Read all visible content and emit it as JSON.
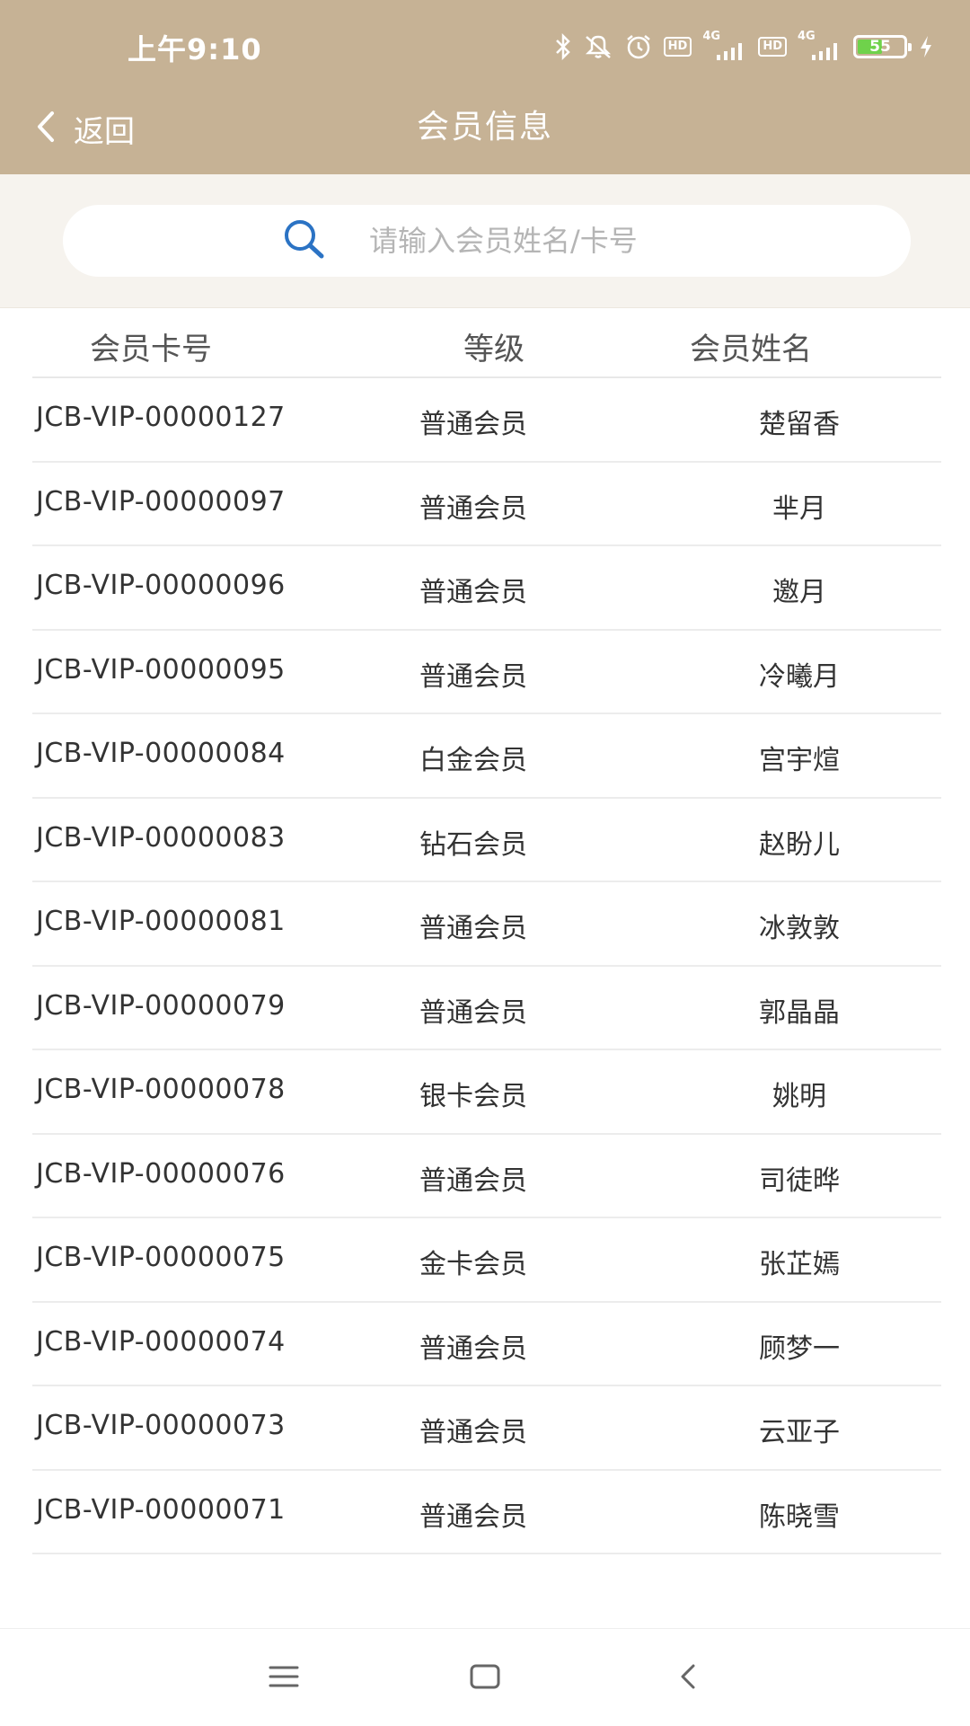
{
  "status_bar": {
    "time": "上午9:10",
    "icons": [
      "bluetooth-icon",
      "mute-icon",
      "alarm-icon",
      "hd-badge",
      "4g-signal-icon",
      "hd-badge",
      "4g-signal-icon",
      "battery-icon",
      "charging-icon"
    ],
    "hd_label": "HD",
    "network_label": "4G",
    "battery_level": 55,
    "battery_text": "55",
    "battery_color": "#6fd24b"
  },
  "header": {
    "back_label": "返回",
    "title": "会员信息",
    "background": "#c6b295"
  },
  "search": {
    "placeholder": "请输入会员姓名/卡号",
    "value": "",
    "icon": "search-icon",
    "icon_color": "#2b73c4"
  },
  "table": {
    "columns": [
      "会员卡号",
      "等级",
      "会员姓名"
    ],
    "rows": [
      {
        "card": "JCB-VIP-00000127",
        "level": "普通会员",
        "name": "楚留香"
      },
      {
        "card": "JCB-VIP-00000097",
        "level": "普通会员",
        "name": "芈月"
      },
      {
        "card": "JCB-VIP-00000096",
        "level": "普通会员",
        "name": "邀月"
      },
      {
        "card": "JCB-VIP-00000095",
        "level": "普通会员",
        "name": "冷曦月"
      },
      {
        "card": "JCB-VIP-00000084",
        "level": "白金会员",
        "name": "宫宇煊"
      },
      {
        "card": "JCB-VIP-00000083",
        "level": "钻石会员",
        "name": "赵盼儿"
      },
      {
        "card": "JCB-VIP-00000081",
        "level": "普通会员",
        "name": "冰敦敦"
      },
      {
        "card": "JCB-VIP-00000079",
        "level": "普通会员",
        "name": "郭晶晶"
      },
      {
        "card": "JCB-VIP-00000078",
        "level": "银卡会员",
        "name": "姚明"
      },
      {
        "card": "JCB-VIP-00000076",
        "level": "普通会员",
        "name": "司徒晔"
      },
      {
        "card": "JCB-VIP-00000075",
        "level": "金卡会员",
        "name": "张芷嫣"
      },
      {
        "card": "JCB-VIP-00000074",
        "level": "普通会员",
        "name": "顾梦一"
      },
      {
        "card": "JCB-VIP-00000073",
        "level": "普通会员",
        "name": "云亚子"
      },
      {
        "card": "JCB-VIP-00000071",
        "level": "普通会员",
        "name": "陈晓雪"
      }
    ]
  },
  "system_nav": {
    "buttons": [
      "menu-icon",
      "home-icon",
      "back-icon"
    ]
  }
}
